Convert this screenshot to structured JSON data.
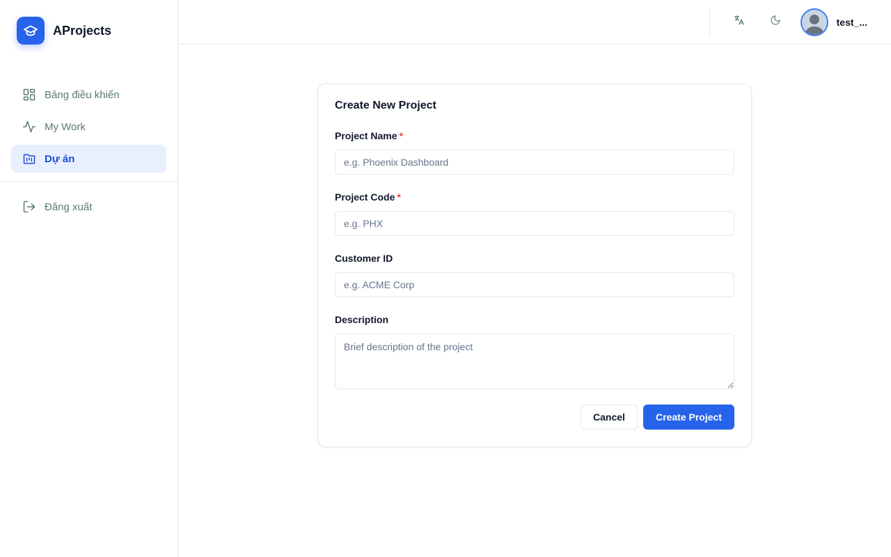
{
  "brand": {
    "name": "AProjects",
    "icon": "graduation-cap-icon",
    "color": "#2563eb"
  },
  "sidebar": {
    "items": [
      {
        "label": "Bảng điều khiển",
        "icon": "dashboard-grid-icon",
        "active": false
      },
      {
        "label": "My Work",
        "icon": "activity-icon",
        "active": false
      },
      {
        "label": "Dự án",
        "icon": "kanban-folder-icon",
        "active": true
      }
    ],
    "logout": {
      "label": "Đăng xuất",
      "icon": "logout-icon"
    }
  },
  "header": {
    "translate_icon": "translate-icon",
    "theme_icon": "moon-icon",
    "user": {
      "name": "test_..."
    }
  },
  "form": {
    "title": "Create New Project",
    "project_name": {
      "label": "Project Name",
      "required_mark": "*",
      "placeholder": "e.g. Phoenix Dashboard",
      "value": ""
    },
    "project_code": {
      "label": "Project Code",
      "required_mark": "*",
      "placeholder": "e.g. PHX",
      "value": ""
    },
    "customer_id": {
      "label": "Customer ID",
      "placeholder": "e.g. ACME Corp",
      "value": ""
    },
    "description": {
      "label": "Description",
      "placeholder": "Brief description of the project",
      "value": ""
    },
    "cancel_label": "Cancel",
    "submit_label": "Create Project"
  },
  "colors": {
    "accent": "#2563eb",
    "active_bg": "#e8effe",
    "required": "#ef4444"
  }
}
